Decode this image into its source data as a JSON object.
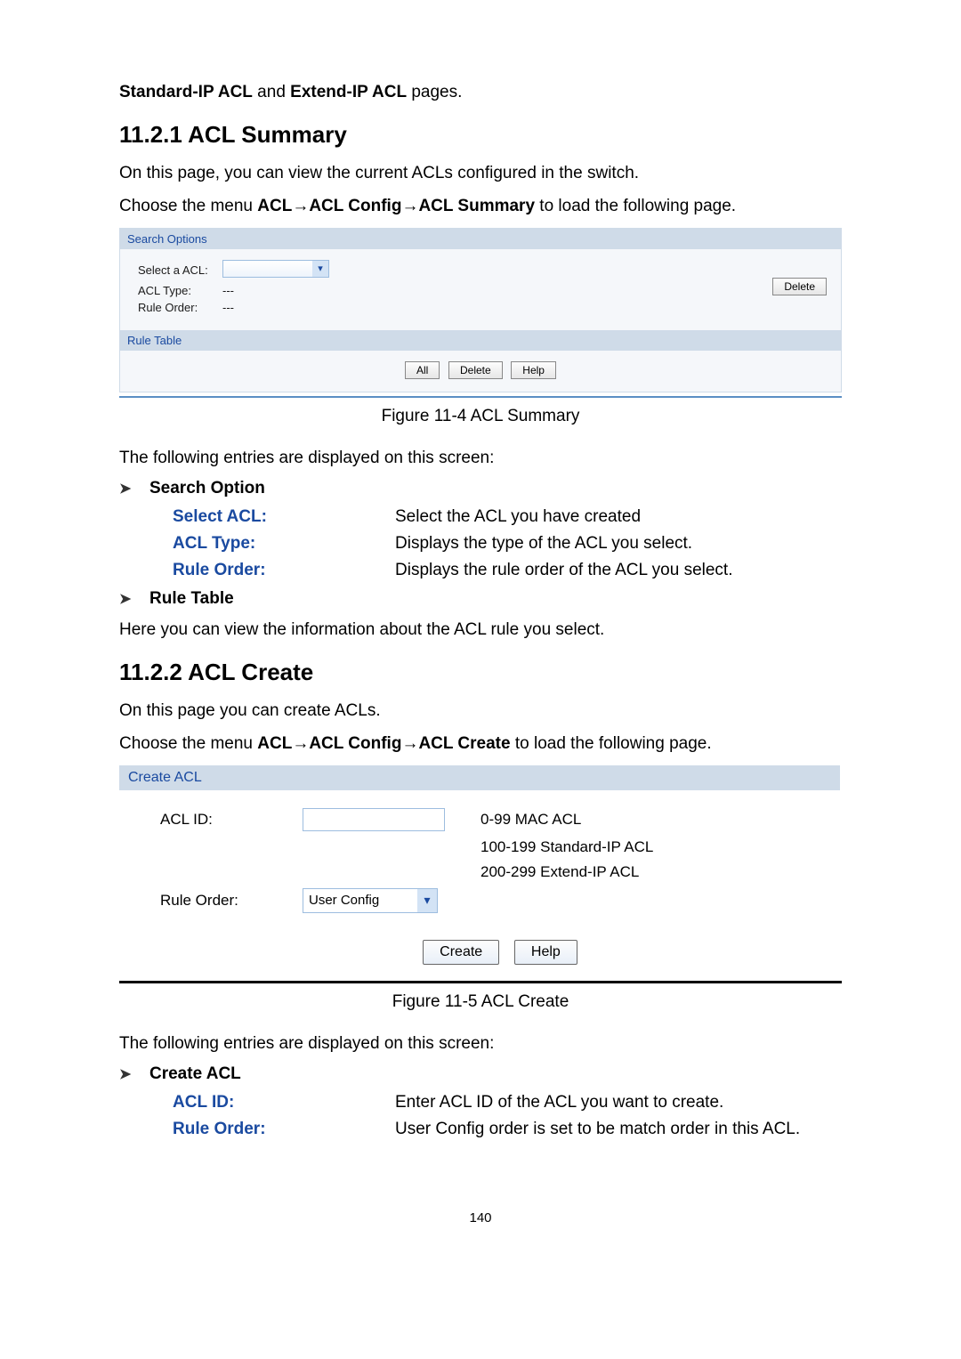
{
  "intro_line": {
    "bold_a": "Standard-IP ACL",
    "mid": " and ",
    "bold_b": "Extend-IP ACL",
    "tail": " pages."
  },
  "sec1": {
    "heading": "11.2.1  ACL Summary",
    "p1": "On this page, you can view the current ACLs configured in the switch.",
    "p2_a": "Choose the menu ",
    "p2_b": "ACL→ACL Config→ACL Summary",
    "p2_c": " to load the following page.",
    "panel": {
      "search_title": "Search Options",
      "select_acl_label": "Select a ACL:",
      "acl_type_label": "ACL Type:",
      "acl_type_value": "---",
      "rule_order_label": "Rule Order:",
      "rule_order_value": "---",
      "delete_btn": "Delete",
      "rule_table_title": "Rule Table",
      "btn_all": "All",
      "btn_delete": "Delete",
      "btn_help": "Help"
    },
    "fig_caption": "Figure 11-4 ACL Summary",
    "entries_intro": "The following entries are displayed on this screen:",
    "bul_search": "Search Option",
    "def1_t": "Select ACL:",
    "def1_d": "Select the ACL you have created",
    "def2_t": "ACL Type:",
    "def2_d": "Displays the type of the ACL you select.",
    "def3_t": "Rule Order:",
    "def3_d": "Displays the rule order of the ACL you select.",
    "bul_rule": "Rule Table",
    "rule_p": "Here you can view the information about the ACL rule you select."
  },
  "sec2": {
    "heading": "11.2.2  ACL Create",
    "p1": "On this page you can create ACLs.",
    "p2_a": "Choose the menu ",
    "p2_b": "ACL→ACL Config→ACL Create",
    "p2_c": " to load the following page.",
    "panel": {
      "title": "Create ACL",
      "acl_id_label": "ACL ID:",
      "note1": "0-99 MAC ACL",
      "note2": "100-199 Standard-IP ACL",
      "note3": "200-299 Extend-IP ACL",
      "rule_order_label": "Rule Order:",
      "rule_order_value": "User Config",
      "btn_create": "Create",
      "btn_help": "Help"
    },
    "fig_caption": "Figure 11-5 ACL Create",
    "entries_intro": "The following entries are displayed on this screen:",
    "bul_create": "Create ACL",
    "def1_t": "ACL ID:",
    "def1_d": "Enter ACL ID of the ACL you want to create.",
    "def2_t": "Rule Order:",
    "def2_d": "User Config order is set to be match order in this ACL."
  },
  "page_number": "140"
}
